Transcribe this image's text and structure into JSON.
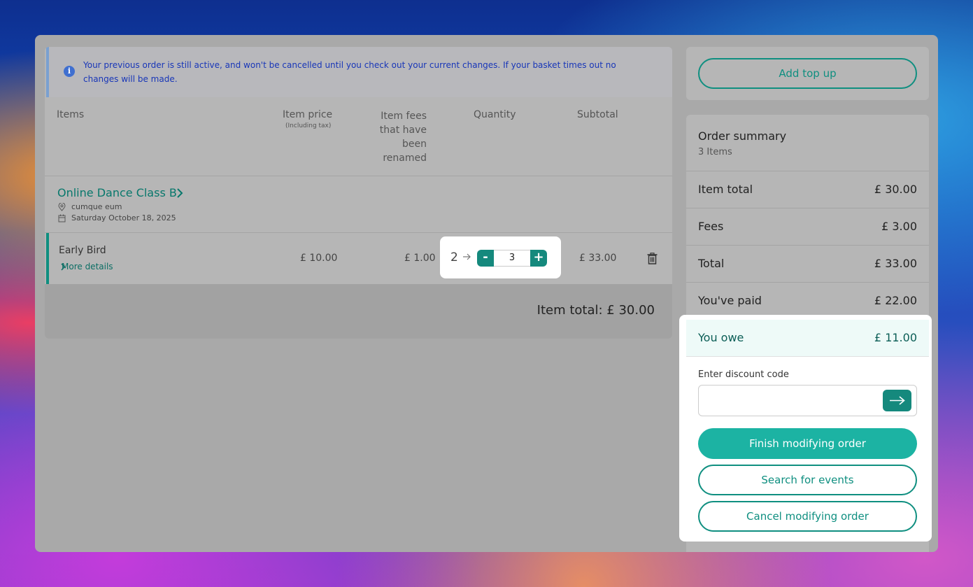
{
  "banner": {
    "icon": "info-icon",
    "message": "Your previous order is still active, and won't be cancelled until you check out your current changes. If your basket times out no changes will be made."
  },
  "table": {
    "headers": {
      "items": "Items",
      "item_price": "Item price",
      "item_price_sub": "(Including tax)",
      "item_fees": "Item fees that have been renamed",
      "quantity": "Quantity",
      "subtotal": "Subtotal"
    }
  },
  "event": {
    "name": "Online Dance Class B",
    "location": "cumque eum",
    "date": "Saturday October 18, 2025"
  },
  "ticket": {
    "name": "Early Bird",
    "more_details": "More details",
    "price": "£ 10.00",
    "fees": "£ 1.00",
    "old_quantity": "2",
    "quantity": "3",
    "minus": "-",
    "plus": "+",
    "subtotal": "£ 33.00"
  },
  "item_total": "Item total: £ 30.00",
  "sidebar": {
    "add_top_up": "Add top up",
    "summary_title": "Order summary",
    "summary_count": "3 Items",
    "rows": [
      {
        "label": "Item total",
        "value": "£ 30.00"
      },
      {
        "label": "Fees",
        "value": "£ 3.00"
      },
      {
        "label": "Total",
        "value": "£ 33.00"
      },
      {
        "label": "You've paid",
        "value": "£ 22.00"
      }
    ],
    "owe": {
      "label": "You owe",
      "value": "£ 11.00"
    },
    "discount_label": "Enter discount code",
    "discount_placeholder": "",
    "finish_button": "Finish modifying order",
    "search_button": "Search for events",
    "cancel_button": "Cancel modifying order"
  },
  "colors": {
    "accent": "#1cb3a3",
    "accent_dark": "#15897d",
    "banner_text": "#1836b8"
  }
}
